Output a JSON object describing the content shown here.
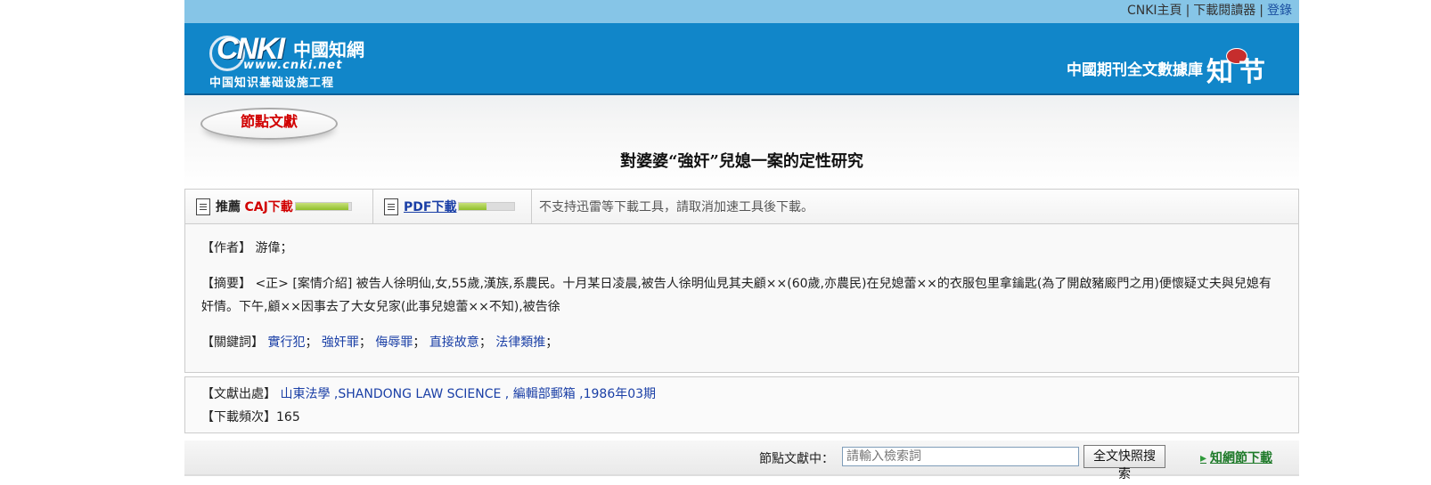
{
  "topnav": {
    "home": "CNKI主頁",
    "reader": "下載閱讀器",
    "login": "登錄",
    "separator": "|"
  },
  "logo": {
    "brand": "CNKI",
    "brand_cn": "中國知網",
    "url": "www.cnki.net",
    "subtitle": "中国知识基础设施工程"
  },
  "header": {
    "db_name": "中國期刊全文數據庫",
    "zhiwang_logo": "知網節"
  },
  "node_badge": "節點文獻",
  "article": {
    "title": "對婆婆“強奸”兒媳一案的定性研究"
  },
  "download": {
    "recommend": "推薦",
    "caj_label": "CAJ下載",
    "caj_meter": 0.95,
    "pdf_label": "PDF下載",
    "pdf_meter": 0.5,
    "note": "不支持迅雷等下載工具，請取消加速工具後下載。"
  },
  "meta": {
    "author_label": "【作者】",
    "author": "游偉；",
    "abstract_label": "【摘要】",
    "abstract": "<正> [案情介紹] 被告人徐明仙,女,55歲,漢族,系農民。十月某日凌晨,被告人徐明仙見其夫顧××(60歲,亦農民)在兒媳蕾××的衣服包里拿鑰匙(為了開啟豬廄門之用)便懷疑丈夫與兒媳有奸情。下午,顧××因事去了大女兒家(此事兒媳蕾××不知),被告徐",
    "keywords_label": "【關鍵詞】",
    "keywords": [
      "實行犯",
      "強奸罪",
      "侮辱罪",
      "直接故意",
      "法律類推"
    ],
    "keyword_sep": "；"
  },
  "source": {
    "label": "【文獻出處】",
    "value": "山東法學 ,SHANDONG LAW SCIENCE , 編輯部郵箱 ,1986年03期",
    "dl_label": "【下載頻次】",
    "dl_count": "165"
  },
  "search": {
    "label": "節點文獻中：",
    "placeholder": "請輸入檢索詞",
    "button": "全文快照搜索",
    "node_download": "知網節下載"
  },
  "icons": {
    "doc": "document-icon",
    "arrow": "arrow-right-icon"
  },
  "colors": {
    "topbar": "#86c5e7",
    "header": "#1186c9",
    "accent_red": "#d10000",
    "link": "#1a3fa6"
  }
}
